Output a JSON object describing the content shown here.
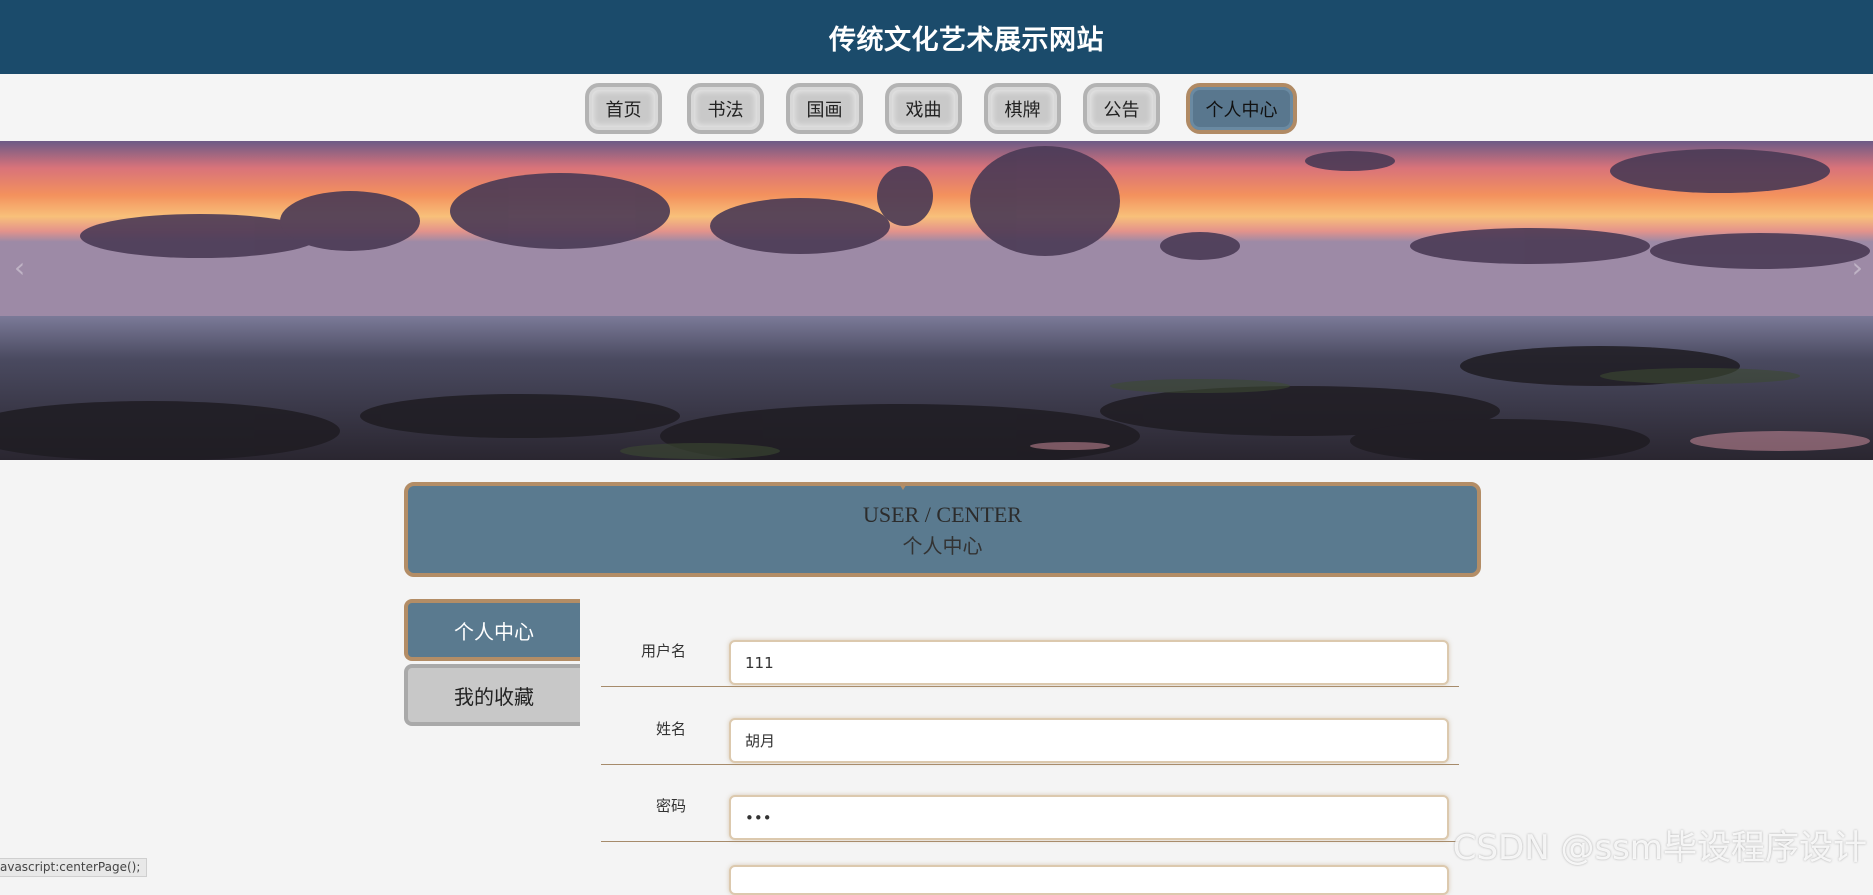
{
  "header": {
    "title": "传统文化艺术展示网站"
  },
  "nav": {
    "items": [
      {
        "label": "首页"
      },
      {
        "label": "书法"
      },
      {
        "label": "国画"
      },
      {
        "label": "戏曲"
      },
      {
        "label": "棋牌"
      },
      {
        "label": "公告"
      },
      {
        "label": "个人中心"
      }
    ],
    "active": "个人中心"
  },
  "banner": {
    "prev_icon": "chevron-left-icon",
    "next_icon": "chevron-right-icon"
  },
  "section": {
    "title_en": "USER / CENTER",
    "title_cn": "个人中心"
  },
  "sidebar": {
    "items": [
      {
        "label": "个人中心"
      },
      {
        "label": "我的收藏"
      }
    ]
  },
  "form": {
    "fields": [
      {
        "label": "用户名",
        "value": "111"
      },
      {
        "label": "姓名",
        "value": "胡月"
      },
      {
        "label": "密码",
        "value": "•••"
      }
    ]
  },
  "statusbar": {
    "text": "avascript:centerPage();"
  },
  "watermark": {
    "text": "CSDN @ssm毕设程序设计"
  },
  "colors": {
    "header_bg": "#1b4b6b",
    "accent": "#5a7a8f",
    "border_accent": "#b38d66"
  }
}
